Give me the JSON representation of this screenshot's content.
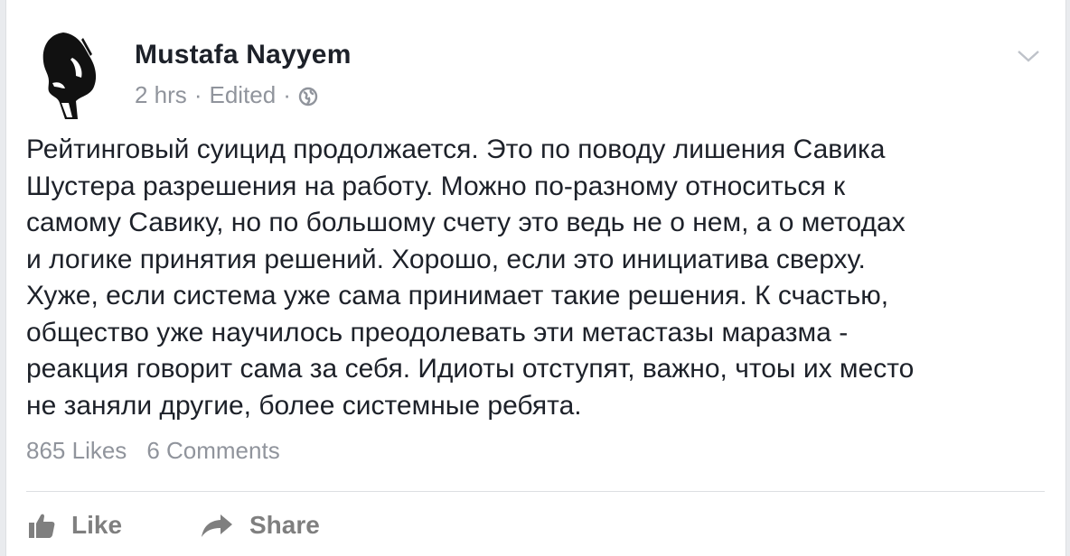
{
  "post": {
    "author": "Mustafa Nayyem",
    "time": "2 hrs",
    "separator": "·",
    "edited": "Edited",
    "privacy_icon": "globe-icon",
    "menu_icon": "chevron-down-icon",
    "text_lines": [
      "Рейтинговый суицид продолжается. Это по поводу лишения Савика",
      "Шустера разрешения на работу. Можно по-разному относиться к",
      "самому Савику, но по большому счету это ведь не о нем, а о методах",
      "и логике принятия решений. Хорошо, если это инициатива сверху.",
      "Хуже, если система уже сама принимает такие решения. К счастью,",
      "общество уже научилось преодолевать эти метастазы маразма -",
      "реакция говорит сама за себя. Идиоты отступят, важно, чтоы их место",
      "не заняли другие, более системные ребята."
    ],
    "likes": "865 Likes",
    "comments": "6 Comments"
  },
  "actions": {
    "like_label": "Like",
    "like_icon": "thumbs-up-icon",
    "share_label": "Share",
    "share_icon": "share-arrow-icon"
  },
  "colors": {
    "text": "#1d2129",
    "muted": "#90949c",
    "action": "#7f7f7f",
    "divider": "#dddfe2"
  }
}
